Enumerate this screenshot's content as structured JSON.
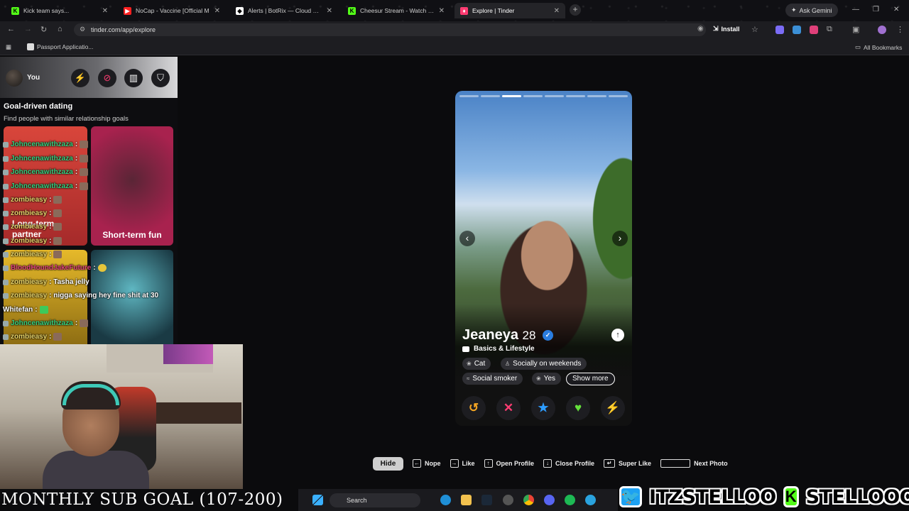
{
  "browser": {
    "tabs": [
      {
        "title": "Kick team says...",
        "color": "#53fc18",
        "glyph": "K"
      },
      {
        "title": "NoCap - Vaccine [Official M",
        "color": "#ff2020",
        "glyph": "▶"
      },
      {
        "title": "Alerts | BotRix — Cloud Stream...",
        "color": "#ffffff",
        "glyph": "◆"
      },
      {
        "title": "Cheesur Stream - Watch Live o",
        "color": "#53fc18",
        "glyph": "K"
      },
      {
        "title": "Explore | Tinder",
        "color": "#fe3c72",
        "glyph": "🔥"
      }
    ],
    "ask_gemini": "Ask Gemini",
    "url": "tinder.com/app/explore",
    "install": "Install",
    "bookmark": "Passport Applicatio...",
    "all_bookmarks": "All Bookmarks"
  },
  "sidebar": {
    "you_label": "You",
    "goal_title": "Goal-driven dating",
    "goal_subtitle": "Find people with similar relationship goals",
    "cards": [
      {
        "label": "Long-term partner"
      },
      {
        "label": "Short-term fun"
      }
    ]
  },
  "chat": [
    {
      "user": "Johncenawithzaza",
      "msg": ":",
      "color": "#35d07f"
    },
    {
      "user": "Johncenawithzaza",
      "msg": ":",
      "color": "#35d07f"
    },
    {
      "user": "Johncenawithzaza",
      "msg": ":",
      "color": "#35d07f"
    },
    {
      "user": "Johncenawithzaza",
      "msg": ":",
      "color": "#35d07f"
    },
    {
      "user": "zombieasy",
      "msg": ":",
      "color": "#e6d36a"
    },
    {
      "user": "zombieasy",
      "msg": ":",
      "color": "#e6d36a"
    },
    {
      "user": "zombieasy",
      "msg": ":",
      "color": "#e6d36a"
    },
    {
      "user": "zombieasy",
      "msg": ":",
      "color": "#e6d36a"
    },
    {
      "user": "zombieasy",
      "msg": ":",
      "color": "#e6d36a"
    },
    {
      "user": "BloodHoundJakeFuture",
      "msg": ":",
      "color": "#e0407a"
    },
    {
      "user": "zombieasy",
      "msg": ": Tasha jelly",
      "color": "#e6d36a"
    },
    {
      "user": "zombieasy",
      "msg": ": nigga saying hey fine shit at 30",
      "color": "#e6d36a"
    },
    {
      "user": "Whitefan",
      "msg": ":",
      "color": "#ffffff"
    },
    {
      "user": "Johncenawithzaza",
      "msg": ":",
      "color": "#35d07f"
    },
    {
      "user": "zombieasy",
      "msg": ":",
      "color": "#e6d36a"
    }
  ],
  "profile": {
    "name": "Jeaneya",
    "age": "28",
    "section": "Basics & Lifestyle",
    "chips": [
      {
        "label": "Cat",
        "icon": "paw-icon"
      },
      {
        "label": "Socially on weekends",
        "icon": "glass-icon"
      },
      {
        "label": "Social smoker",
        "icon": "smoke-icon"
      },
      {
        "label": "Yes",
        "icon": "paw-icon"
      }
    ],
    "show_more": "Show more",
    "photo_count": 8,
    "photo_index": 3
  },
  "hints": {
    "hide": "Hide",
    "nope": "Nope",
    "like": "Like",
    "open_profile": "Open Profile",
    "close_profile": "Close Profile",
    "super_like": "Super Like",
    "next_photo": "Next Photo"
  },
  "overlay": {
    "sub_goal": "MONTHLY SUB GOAL (107-200)",
    "twitter_handle": "ITZSTELLOO",
    "kick_handle": "STELLOOO"
  },
  "taskbar": {
    "search": "Search"
  },
  "colors": {
    "tinder_pink": "#fe3c72",
    "kick_green": "#53fc18",
    "twitter_blue": "#1da1f2"
  }
}
